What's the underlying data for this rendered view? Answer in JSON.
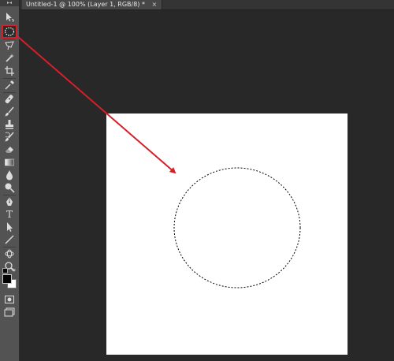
{
  "document": {
    "tab_title": "Untitled-1 @ 100% (Layer 1, RGB/8) *",
    "close_glyph": "×"
  },
  "toolbar": {
    "grip": "▸◂",
    "tools": [
      {
        "name": "move-tool-icon"
      },
      {
        "name": "elliptical-marquee-tool-icon",
        "active": true
      },
      {
        "name": "lasso-tool-icon"
      },
      {
        "name": "quick-selection-tool-icon"
      },
      {
        "name": "crop-tool-icon"
      },
      {
        "name": "eyedropper-tool-icon"
      },
      {
        "name": "spot-healing-brush-tool-icon"
      },
      {
        "name": "brush-tool-icon"
      },
      {
        "name": "clone-stamp-tool-icon"
      },
      {
        "name": "history-brush-tool-icon"
      },
      {
        "name": "eraser-tool-icon"
      },
      {
        "name": "gradient-tool-icon"
      },
      {
        "name": "blur-tool-icon"
      },
      {
        "name": "dodge-tool-icon"
      },
      {
        "name": "pen-tool-icon"
      },
      {
        "name": "type-tool-icon",
        "glyph": "T"
      },
      {
        "name": "path-selection-tool-icon"
      },
      {
        "name": "line-tool-icon"
      },
      {
        "name": "3d-rotate-tool-icon"
      },
      {
        "name": "zoom-tool-icon"
      }
    ],
    "foreground_color": "#000000",
    "background_color": "#ffffff",
    "extra": [
      {
        "name": "quick-mask-icon"
      },
      {
        "name": "screen-mode-icon"
      }
    ]
  },
  "colors": {
    "workspace": "#282828",
    "toolbar": "#535353",
    "canvas": "#ffffff",
    "selection_marquee": "#000000",
    "annotation_arrow": "#d4202a"
  }
}
